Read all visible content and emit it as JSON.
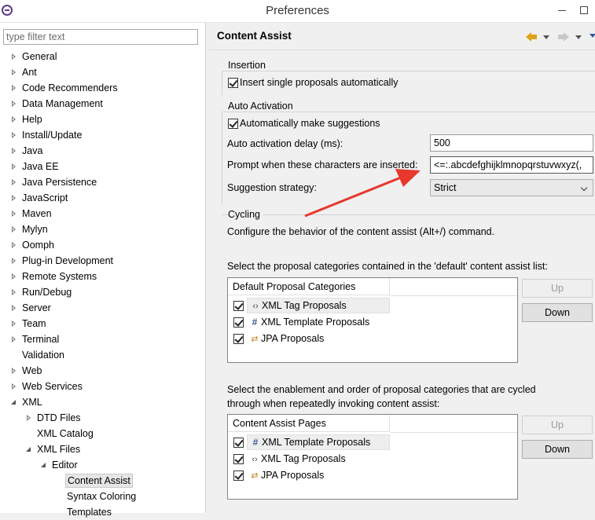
{
  "window": {
    "title": "Preferences"
  },
  "filter": {
    "placeholder": "type filter text"
  },
  "tree": {
    "items": [
      {
        "label": "General",
        "state": "collapsed",
        "indent": 0
      },
      {
        "label": "Ant",
        "state": "collapsed",
        "indent": 0
      },
      {
        "label": "Code Recommenders",
        "state": "collapsed",
        "indent": 0
      },
      {
        "label": "Data Management",
        "state": "collapsed",
        "indent": 0
      },
      {
        "label": "Help",
        "state": "collapsed",
        "indent": 0
      },
      {
        "label": "Install/Update",
        "state": "collapsed",
        "indent": 0
      },
      {
        "label": "Java",
        "state": "collapsed",
        "indent": 0
      },
      {
        "label": "Java EE",
        "state": "collapsed",
        "indent": 0
      },
      {
        "label": "Java Persistence",
        "state": "collapsed",
        "indent": 0
      },
      {
        "label": "JavaScript",
        "state": "collapsed",
        "indent": 0
      },
      {
        "label": "Maven",
        "state": "collapsed",
        "indent": 0
      },
      {
        "label": "Mylyn",
        "state": "collapsed",
        "indent": 0
      },
      {
        "label": "Oomph",
        "state": "collapsed",
        "indent": 0
      },
      {
        "label": "Plug-in Development",
        "state": "collapsed",
        "indent": 0
      },
      {
        "label": "Remote Systems",
        "state": "collapsed",
        "indent": 0
      },
      {
        "label": "Run/Debug",
        "state": "collapsed",
        "indent": 0
      },
      {
        "label": "Server",
        "state": "collapsed",
        "indent": 0
      },
      {
        "label": "Team",
        "state": "collapsed",
        "indent": 0
      },
      {
        "label": "Terminal",
        "state": "collapsed",
        "indent": 0
      },
      {
        "label": "Validation",
        "state": "leaf",
        "indent": 0
      },
      {
        "label": "Web",
        "state": "collapsed",
        "indent": 0
      },
      {
        "label": "Web Services",
        "state": "collapsed",
        "indent": 0
      },
      {
        "label": "XML",
        "state": "expanded",
        "indent": 0
      },
      {
        "label": "DTD Files",
        "state": "collapsed",
        "indent": 1
      },
      {
        "label": "XML Catalog",
        "state": "leaf",
        "indent": 1
      },
      {
        "label": "XML Files",
        "state": "expanded",
        "indent": 1
      },
      {
        "label": "Editor",
        "state": "expanded",
        "indent": 2
      },
      {
        "label": "Content Assist",
        "state": "leaf",
        "indent": 3,
        "selected": true
      },
      {
        "label": "Syntax Coloring",
        "state": "leaf",
        "indent": 3
      },
      {
        "label": "Templates",
        "state": "leaf",
        "indent": 3
      }
    ]
  },
  "page": {
    "title": "Content Assist"
  },
  "insertion": {
    "title": "Insertion",
    "single_proposals_label": "Insert single proposals automatically",
    "single_proposals_checked": true
  },
  "auto_activation": {
    "title": "Auto Activation",
    "make_suggestions_label": "Automatically make suggestions",
    "make_suggestions_checked": true,
    "delay_label": "Auto activation delay (ms):",
    "delay_value": "500",
    "prompt_label": "Prompt when these characters are inserted:",
    "prompt_value": "<=:.abcdefghijklmnopqrstuvwxyz(,",
    "strategy_label": "Suggestion strategy:",
    "strategy_value": "Strict"
  },
  "cycling": {
    "title": "Cycling",
    "description": "Configure the behavior of the content assist (Alt+/) command.",
    "default_list_label": "Select the proposal categories contained in the 'default' content assist list:",
    "default_list_header": "Default Proposal Categories",
    "default_items": [
      {
        "icon": "xml-tag",
        "label": "XML Tag Proposals",
        "checked": true,
        "selected": true
      },
      {
        "icon": "template",
        "label": "XML Template Proposals",
        "checked": true,
        "selected": false
      },
      {
        "icon": "jpa",
        "label": "JPA Proposals",
        "checked": true,
        "selected": false
      }
    ],
    "cycled_list_label_1": "Select the enablement and order of proposal categories that are cycled",
    "cycled_list_label_2": "through when repeatedly invoking content assist:",
    "cycled_list_header": "Content Assist Pages",
    "cycled_items": [
      {
        "icon": "template",
        "label": "XML Template Proposals",
        "checked": true,
        "selected": true
      },
      {
        "icon": "xml-tag",
        "label": "XML Tag Proposals",
        "checked": true,
        "selected": false
      },
      {
        "icon": "jpa",
        "label": "JPA Proposals",
        "checked": true,
        "selected": false
      }
    ],
    "up_label": "Up",
    "down_label": "Down"
  },
  "colors": {
    "annotation_arrow": "#e8372c",
    "back_arrow": "#e0a318"
  }
}
